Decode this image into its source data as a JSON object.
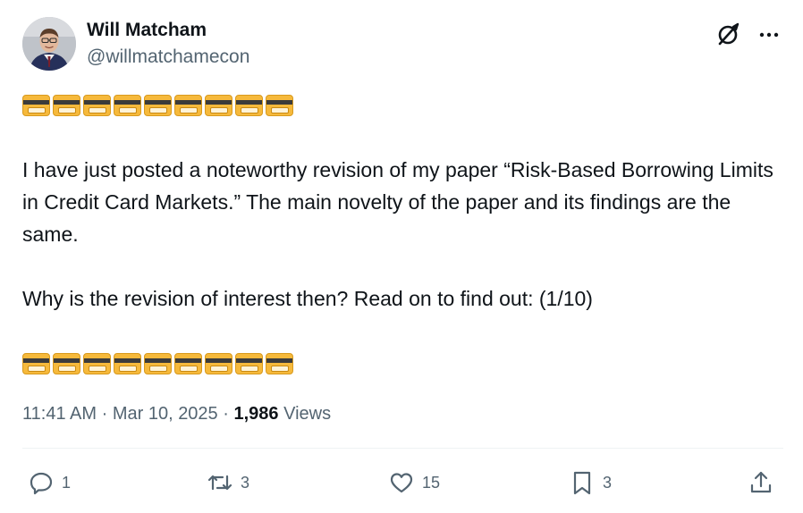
{
  "author": {
    "name": "Will Matcham",
    "handle": "@willmatchamecon"
  },
  "header_icons": {
    "grok": "grok-icon",
    "more": "more-icon"
  },
  "tweet": {
    "emoji_row": "💳💳💳💳💳💳💳💳💳",
    "paragraph_1": "I have just posted a noteworthy revision of my paper “Risk-Based Borrowing Limits in Credit Card Markets.” The main novelty of the paper and its findings are the same.",
    "paragraph_2": "Why is the revision of interest then? Read on to find out: (1/10)"
  },
  "meta": {
    "time": "11:41 AM",
    "separator": "·",
    "date": "Mar 10, 2025",
    "views_count": "1,986",
    "views_label": "Views"
  },
  "actions": {
    "replies": "1",
    "reposts": "3",
    "likes": "15",
    "bookmarks": "3"
  },
  "colors": {
    "text": "#0f1419",
    "secondary": "#536471",
    "divider": "#eff3f4"
  }
}
